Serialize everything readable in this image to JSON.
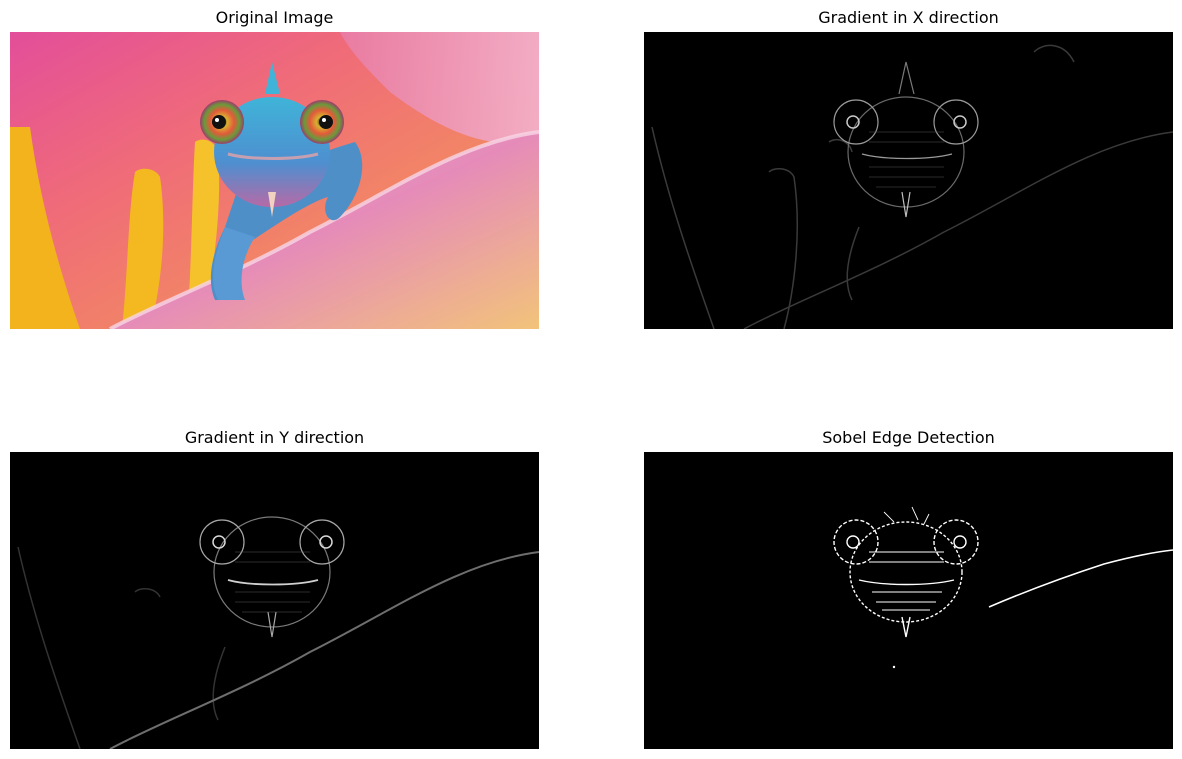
{
  "figure": {
    "panels": [
      {
        "title": "Original Image"
      },
      {
        "title": "Gradient in X direction"
      },
      {
        "title": "Gradient in Y direction"
      },
      {
        "title": "Sobel Edge Detection"
      }
    ]
  },
  "colors": {
    "background": "#ffffff",
    "edge_background": "#000000",
    "petal_pink": "#e98ab6",
    "stamen_yellow": "#f2b31d",
    "chameleon_blue": "#4f9ed6"
  }
}
